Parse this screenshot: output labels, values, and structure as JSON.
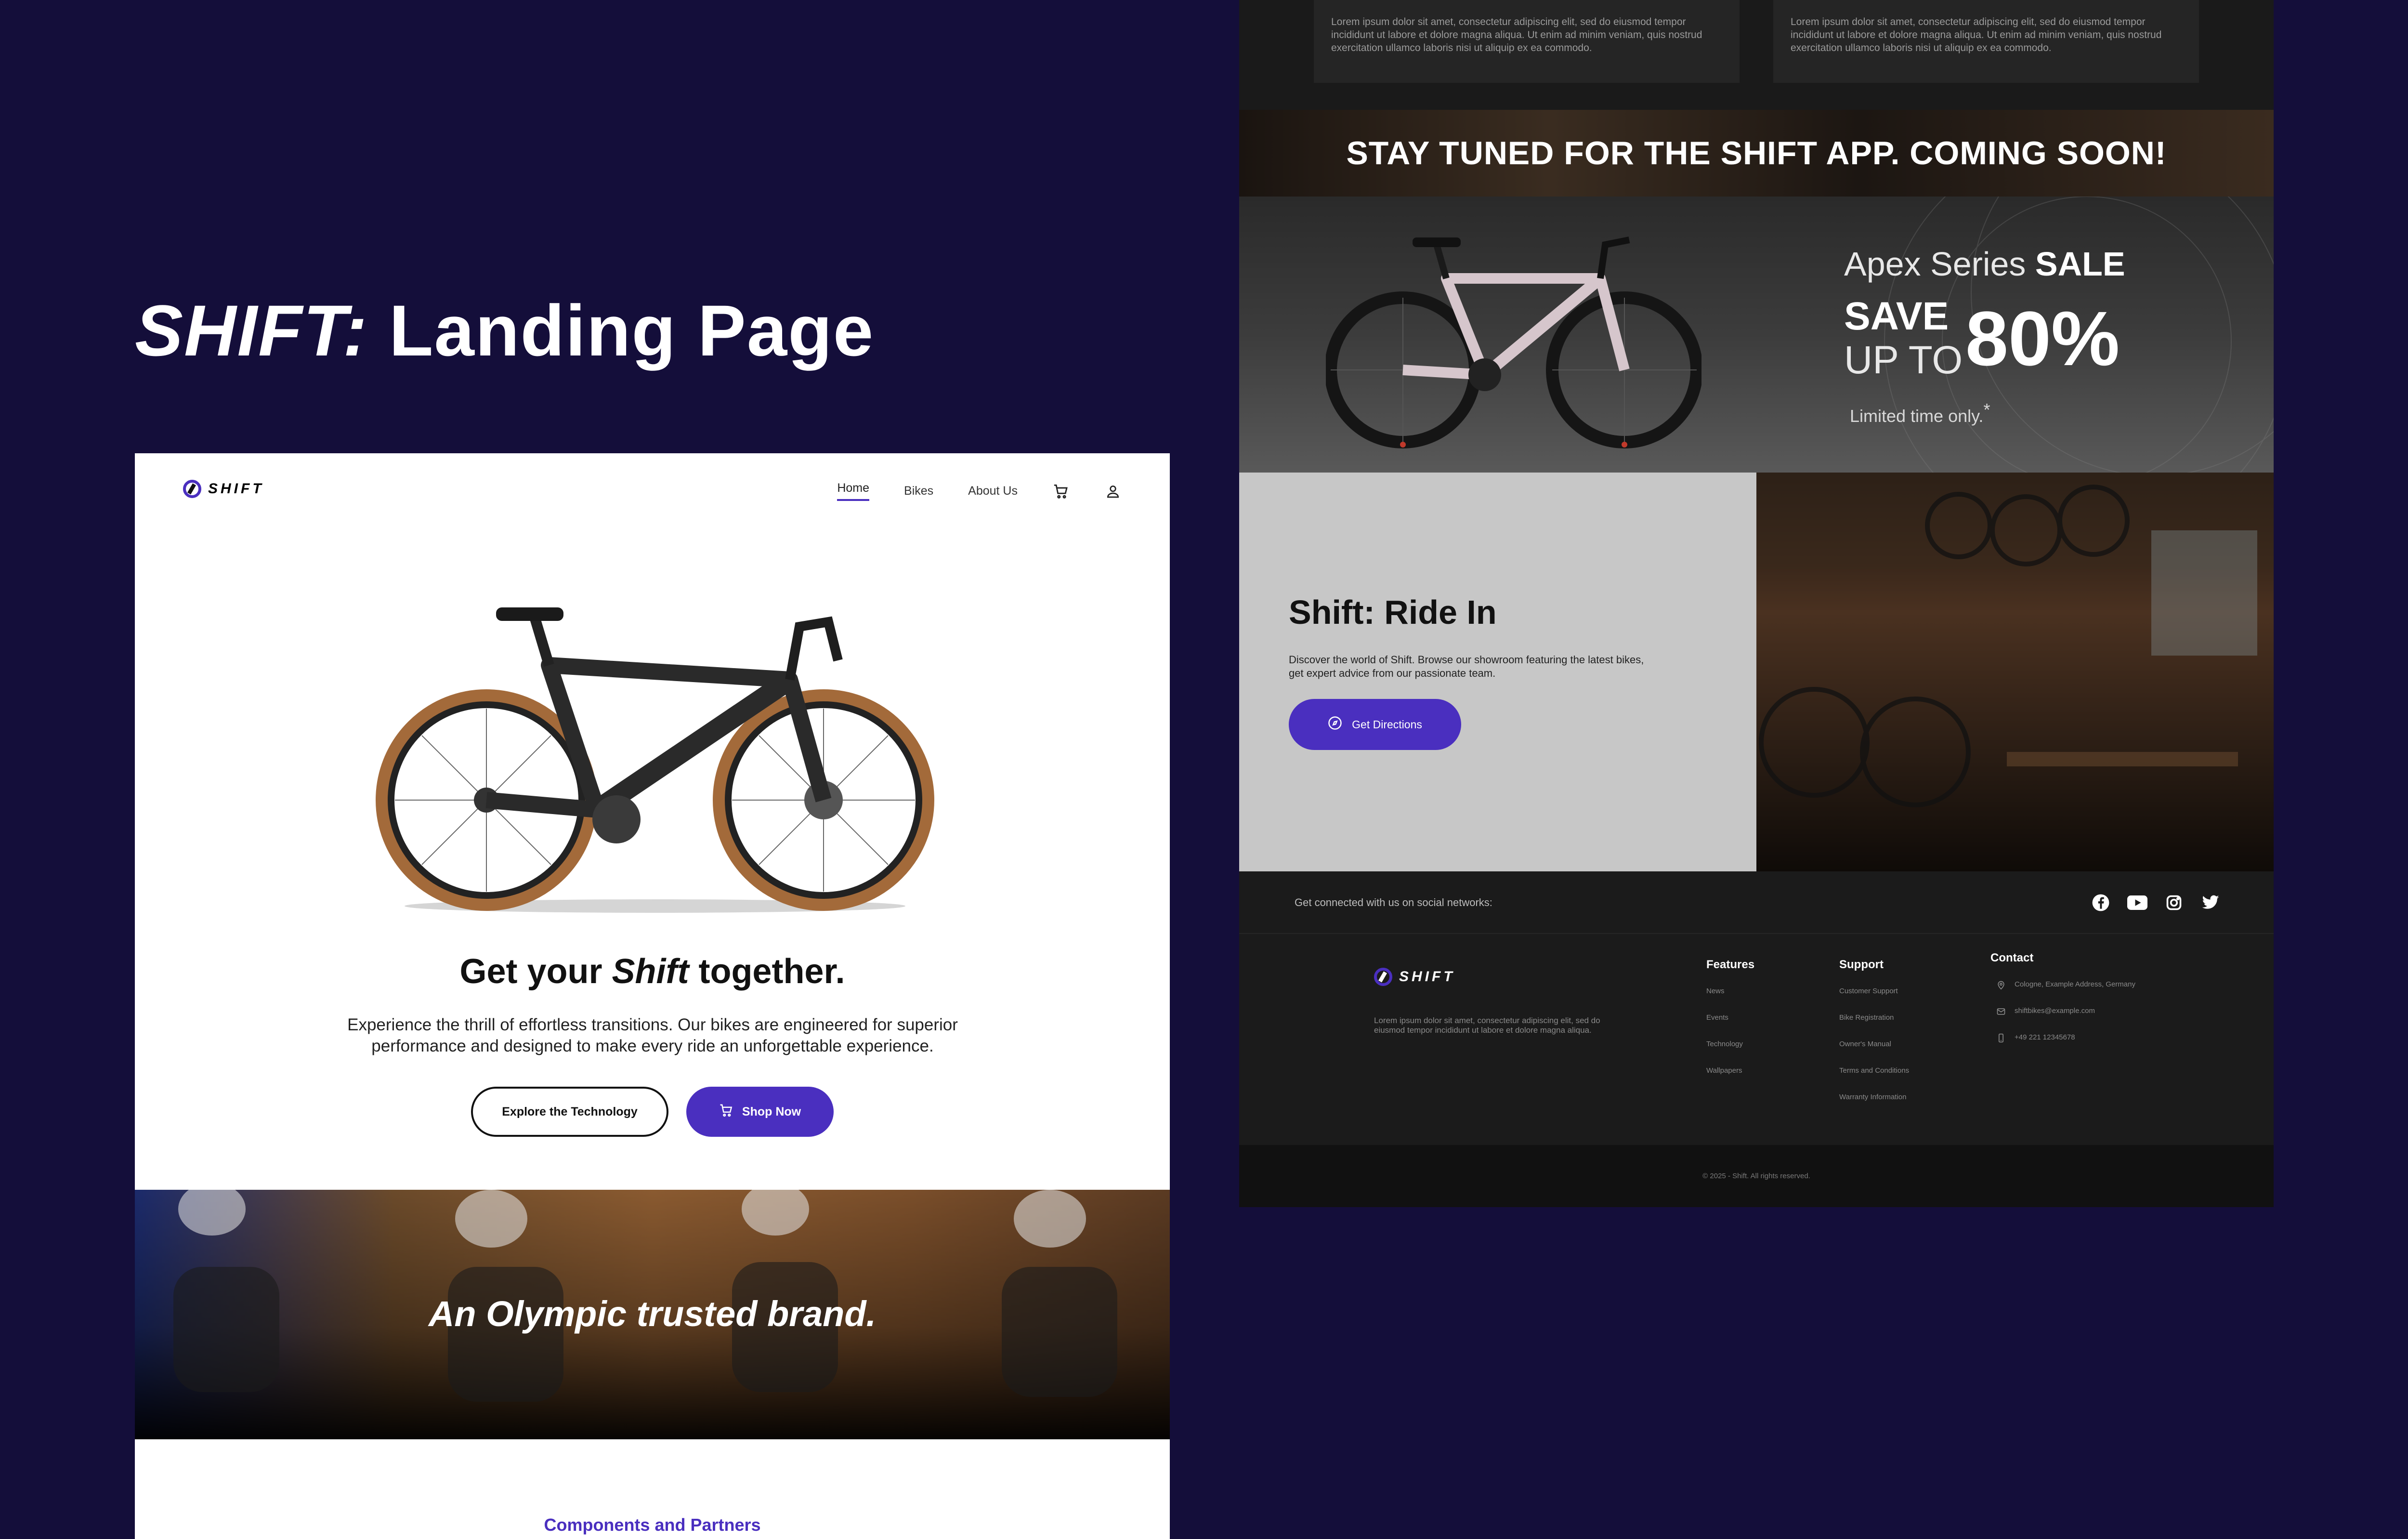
{
  "presentation": {
    "title_brand": "SHIFT:",
    "title_rest": " Landing Page"
  },
  "landing": {
    "logo_text": "SHIFT",
    "nav": [
      {
        "label": "Home",
        "active": true
      },
      {
        "label": "Bikes",
        "active": false
      },
      {
        "label": "About Us",
        "active": false
      }
    ],
    "hero": {
      "title_pre": "Get your ",
      "title_em": "Shift",
      "title_post": " together.",
      "description": "Experience the thrill of effortless transitions. Our bikes are engineered for superior performance and designed to make every ride an unforgettable experience.",
      "btn_explore": "Explore the Technology",
      "btn_shop": "Shop Now"
    },
    "olympic_banner": "An Olympic trusted brand.",
    "components_heading": "Components and Partners"
  },
  "landing_cont": {
    "lorem_cards": [
      "Lorem ipsum dolor sit amet, consectetur adipiscing elit, sed do eiusmod tempor incididunt ut labore et dolore magna aliqua. Ut enim ad minim veniam, quis nostrud exercitation ullamco laboris nisi ut aliquip ex ea commodo.",
      "Lorem ipsum dolor sit amet, consectetur adipiscing elit, sed do eiusmod tempor incididunt ut labore et dolore magna aliqua. Ut enim ad minim veniam, quis nostrud exercitation ullamco laboris nisi ut aliquip ex ea commodo."
    ],
    "app_banner": "STAY TUNED FOR THE SHIFT APP. COMING SOON!",
    "sale": {
      "series": "Apex Series ",
      "sale_word": "SALE",
      "save": "SAVE",
      "up_to": "UP TO",
      "percent": "80%",
      "limited": "Limited time only.",
      "asterisk": "*"
    },
    "ride_in": {
      "title": "Shift: Ride In",
      "description": "Discover the world of Shift. Browse our showroom featuring the latest bikes, get expert advice from our passionate team.",
      "button": "Get Directions"
    },
    "social": {
      "text": "Get connected with us on social networks:",
      "icons": [
        "facebook-icon",
        "youtube-icon",
        "instagram-icon",
        "twitter-icon"
      ]
    },
    "footer": {
      "logo_text": "SHIFT",
      "description": "Lorem ipsum dolor sit amet, consectetur adipiscing elit, sed do eiusmod tempor incididunt ut labore et dolore magna aliqua.",
      "features": {
        "title": "Features",
        "items": [
          "News",
          "Events",
          "Technology",
          "Wallpapers"
        ]
      },
      "support": {
        "title": "Support",
        "items": [
          "Customer Support",
          "Bike Registration",
          "Owner's Manual",
          "Terms and Conditions",
          "Warranty Information"
        ]
      },
      "contact": {
        "title": "Contact",
        "address": "Cologne, Example Address, Germany",
        "email": "shiftbikes@example.com",
        "phone": "+49 221 12345678"
      },
      "copyright": "© 2025 - Shift. All rights reserved."
    }
  },
  "colors": {
    "background": "#140e3a",
    "accent": "#4a2fbf",
    "dark": "#1a1a1a",
    "light_panel": "#c7c7c7"
  }
}
